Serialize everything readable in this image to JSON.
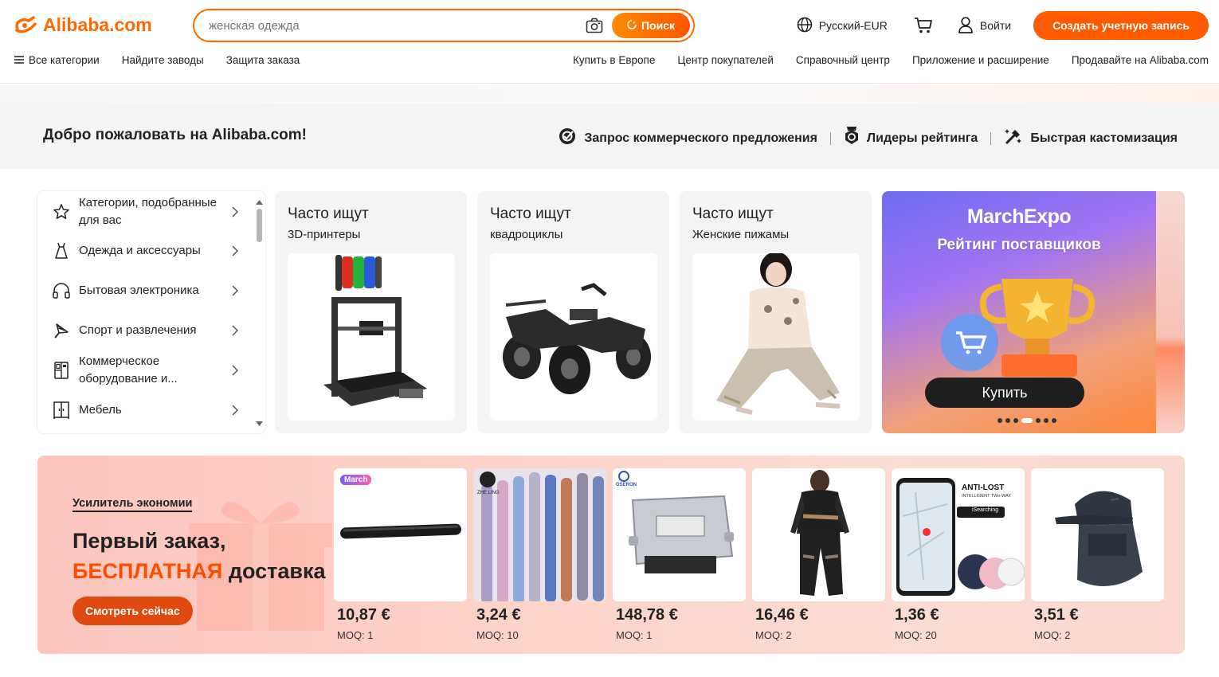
{
  "header": {
    "logo_text": "Alibaba.com",
    "search": {
      "placeholder": "женская одежда",
      "button_label": "Поиск"
    },
    "language": "Русский-EUR",
    "login_label": "Войти",
    "signup_label": "Создать учетную запись"
  },
  "nav": {
    "left": [
      "Все категории",
      "Найдите заводы",
      "Защита заказа"
    ],
    "right": [
      "Купить в Европе",
      "Центр покупателей",
      "Справочный центр",
      "Приложение и расширение",
      "Продавайте на Alibaba.com"
    ]
  },
  "welcome": {
    "title": "Добро пожаловать на Alibaba.com!",
    "links": [
      {
        "label": "Запрос коммерческого предложения",
        "icon": "rfq-icon"
      },
      {
        "label": "Лидеры рейтинга",
        "icon": "medal-icon"
      },
      {
        "label": "Быстрая кастомизация",
        "icon": "customize-icon"
      }
    ]
  },
  "categories": [
    {
      "label": "Категории, подобранные для вас",
      "icon": "star-icon"
    },
    {
      "label": "Одежда и аксессуары",
      "icon": "dress-icon"
    },
    {
      "label": "Бытовая электроника",
      "icon": "headphones-icon"
    },
    {
      "label": "Спорт и развлечения",
      "icon": "badminton-icon"
    },
    {
      "label": "Коммерческое оборудование и...",
      "icon": "vending-icon"
    },
    {
      "label": "Мебель",
      "icon": "wardrobe-icon"
    }
  ],
  "trending": [
    {
      "title": "Часто ищут",
      "subtitle": "3D-принтеры"
    },
    {
      "title": "Часто ищут",
      "subtitle": "квадроциклы"
    },
    {
      "title": "Часто ищут",
      "subtitle": "Женские пижамы"
    }
  ],
  "banner": {
    "brand": "MarchExpo",
    "subtitle": "Рейтинг поставщиков",
    "button_label": "Купить",
    "dots_total": 7,
    "dots_active": 4
  },
  "deals": {
    "kicker": "Усилитель экономии",
    "headline_line1": "Первый заказ,",
    "headline_accent": "БЕСПЛАТНАЯ",
    "headline_rest": "доставка",
    "cta_label": "Смотреть сейчас",
    "tag": "March",
    "products": [
      {
        "price": "10,87 €",
        "moq": "MOQ: 1"
      },
      {
        "price": "3,24 €",
        "moq": "MOQ: 10"
      },
      {
        "price": "148,78 €",
        "moq": "MOQ: 1"
      },
      {
        "price": "16,46 €",
        "moq": "MOQ: 2"
      },
      {
        "price": "1,36 €",
        "moq": "MOQ: 20"
      },
      {
        "price": "3,51 €",
        "moq": "MOQ: 2"
      }
    ],
    "product_labels": {
      "beads_brand": "ZHE LING",
      "ecu_brand": "OSERON",
      "tracker_title": "ANTI-LOST",
      "tracker_sub": "INTELLIGENT TWo-WAY",
      "tracker_badge": "iSearching"
    }
  },
  "colors": {
    "brand": "#ff6a00",
    "signup": "#ff5a00",
    "accent_red": "#ff4d00"
  }
}
